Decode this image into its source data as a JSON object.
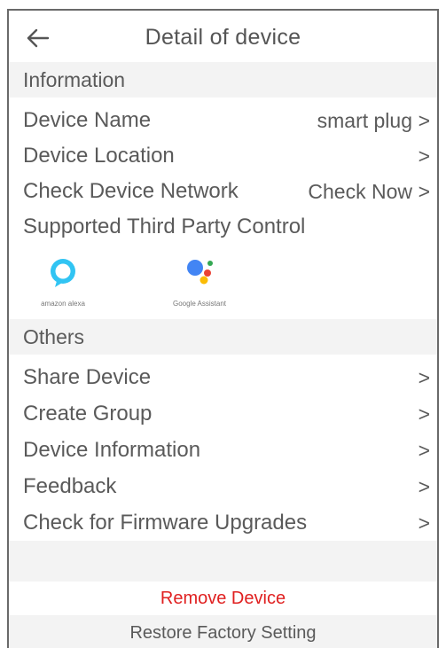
{
  "header": {
    "title": "Detail of device",
    "back_icon": "arrow-left-icon"
  },
  "information": {
    "section_title": "Information",
    "rows": [
      {
        "label": "Device Name",
        "value": "smart plug",
        "chevron": ">"
      },
      {
        "label": "Device Location",
        "value": "",
        "chevron": ">"
      },
      {
        "label": "Check Device Network",
        "value": "Check Now",
        "chevron": ">"
      },
      {
        "label": "Supported Third Party Control",
        "value": "",
        "chevron": ""
      }
    ],
    "third_party": [
      {
        "name": "amazon alexa",
        "icon": "alexa-icon",
        "color": "#31c4f3"
      },
      {
        "name": "Google Assistant",
        "icon": "google-assistant-icon",
        "color": "#4285f4"
      }
    ]
  },
  "others": {
    "section_title": "Others",
    "rows": [
      {
        "label": "Share Device",
        "chevron": ">"
      },
      {
        "label": "Create Group",
        "chevron": ">"
      },
      {
        "label": "Device Information",
        "chevron": ">"
      },
      {
        "label": "Feedback",
        "chevron": ">"
      },
      {
        "label": "Check for Firmware Upgrades",
        "chevron": ">"
      }
    ]
  },
  "actions": {
    "remove_label": "Remove Device",
    "restore_label": "Restore Factory Setting"
  },
  "colors": {
    "danger": "#e02020",
    "section_bg": "#f3f3f3",
    "text": "#5a5a5a"
  }
}
